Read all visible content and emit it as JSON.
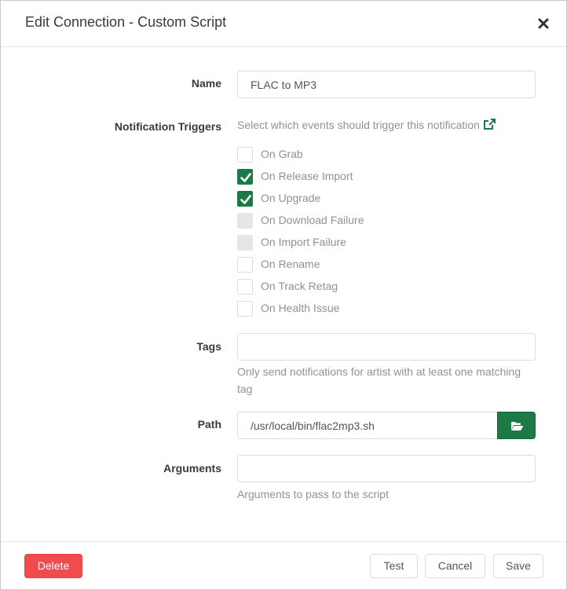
{
  "modal": {
    "title": "Edit Connection - Custom Script",
    "close_icon": "close-icon"
  },
  "form": {
    "name": {
      "label": "Name",
      "value": "FLAC to MP3"
    },
    "notification_triggers": {
      "label": "Notification Triggers",
      "help": "Select which events should trigger this notification",
      "help_link_icon": "external-link-icon",
      "items": [
        {
          "label": "On Grab",
          "checked": false,
          "disabled": false
        },
        {
          "label": "On Release Import",
          "checked": true,
          "disabled": false
        },
        {
          "label": "On Upgrade",
          "checked": true,
          "disabled": false
        },
        {
          "label": "On Download Failure",
          "checked": false,
          "disabled": true
        },
        {
          "label": "On Import Failure",
          "checked": false,
          "disabled": true
        },
        {
          "label": "On Rename",
          "checked": false,
          "disabled": false
        },
        {
          "label": "On Track Retag",
          "checked": false,
          "disabled": false
        },
        {
          "label": "On Health Issue",
          "checked": false,
          "disabled": false
        }
      ]
    },
    "tags": {
      "label": "Tags",
      "value": "",
      "help_line1": "Only send notifications for artist with at least one matching",
      "help_line2": "tag"
    },
    "path": {
      "label": "Path",
      "value": "/usr/local/bin/flac2mp3.sh",
      "browse_icon": "folder-open-icon"
    },
    "arguments": {
      "label": "Arguments",
      "value": "",
      "help": "Arguments to pass to the script"
    }
  },
  "footer": {
    "delete_label": "Delete",
    "test_label": "Test",
    "cancel_label": "Cancel",
    "save_label": "Save"
  },
  "colors": {
    "accent": "#1b7a45",
    "danger": "#f04b4f",
    "checkbox_disabled": "#e6e6e6"
  }
}
